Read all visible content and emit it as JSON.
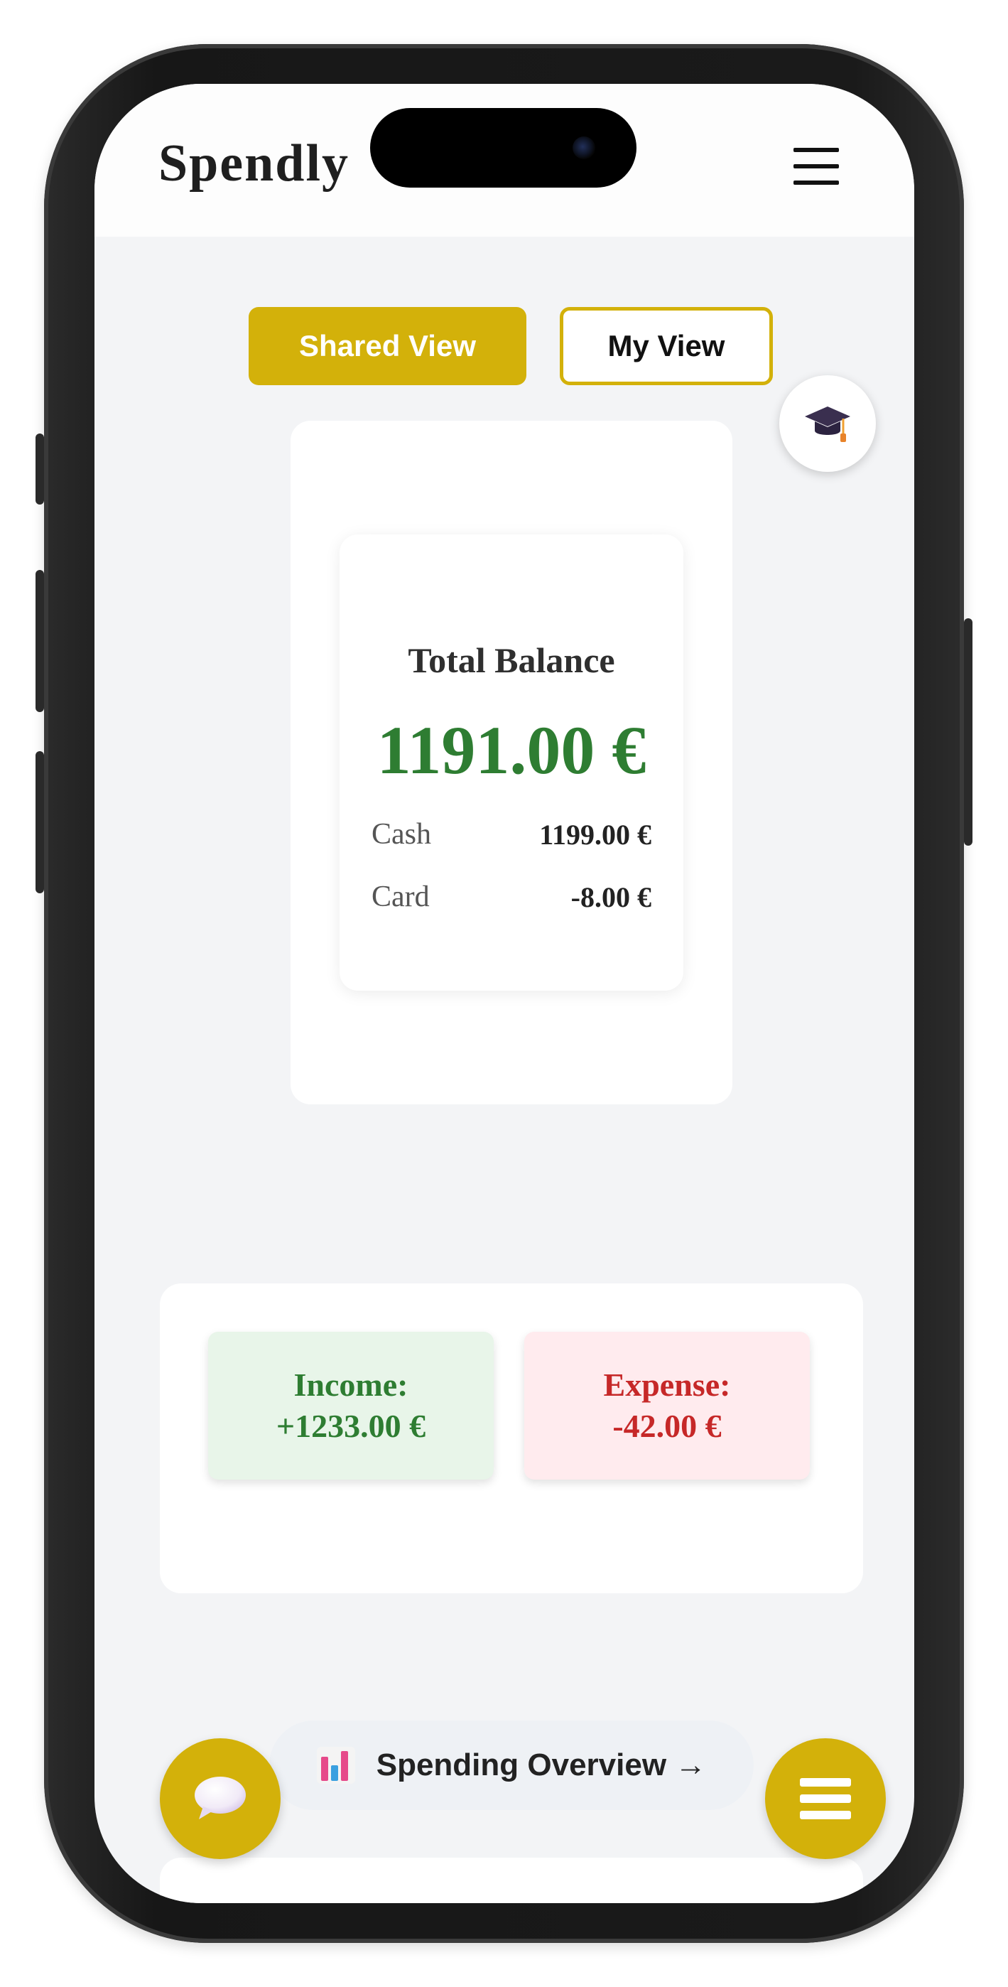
{
  "app": {
    "brand": "Spendly"
  },
  "view_toggle": {
    "shared_label": "Shared View",
    "my_label": "My View",
    "active": "Shared View"
  },
  "balance": {
    "title": "Total Balance",
    "total": "1191.00 €",
    "rows": [
      {
        "label": "Cash",
        "value": "1199.00 €"
      },
      {
        "label": "Card",
        "value": "-8.00 €"
      }
    ]
  },
  "summary": {
    "income_label": "Income:",
    "income_value": "+1233.00 €",
    "expense_label": "Expense:",
    "expense_value": "-42.00 €"
  },
  "overview": {
    "label": "Spending Overview →"
  },
  "icons": {
    "header_menu": "hamburger-icon",
    "learn": "graduation-cap-icon",
    "overview": "bar-chart-icon",
    "chat_fab": "speech-bubble-icon",
    "menu_fab": "hamburger-icon"
  },
  "colors": {
    "accent": "#d3b10a",
    "income": "#2e7d32",
    "expense": "#c62828",
    "income_bg": "#e8f5e9",
    "expense_bg": "#ffebee",
    "background": "#f3f4f6"
  }
}
